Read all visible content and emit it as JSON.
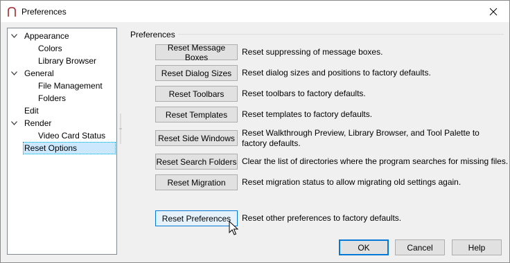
{
  "window": {
    "title": "Preferences"
  },
  "tree": {
    "items": [
      {
        "label": "Appearance",
        "expander": "expanded"
      },
      {
        "label": "Colors"
      },
      {
        "label": "Library Browser"
      },
      {
        "label": "General",
        "expander": "expanded"
      },
      {
        "label": "File Management"
      },
      {
        "label": "Folders"
      },
      {
        "label": "Edit"
      },
      {
        "label": "Render",
        "expander": "expanded"
      },
      {
        "label": "Video Card Status"
      },
      {
        "label": "Reset Options",
        "selected": true
      }
    ]
  },
  "group": {
    "title": "Preferences"
  },
  "resets": [
    {
      "button": "Reset Message Boxes",
      "desc": "Reset suppressing of message boxes."
    },
    {
      "button": "Reset Dialog Sizes",
      "desc": "Reset dialog sizes and positions to factory defaults."
    },
    {
      "button": "Reset Toolbars",
      "desc": "Reset toolbars to factory defaults."
    },
    {
      "button": "Reset Templates",
      "desc": "Reset templates to factory defaults."
    },
    {
      "button": "Reset Side Windows",
      "desc": "Reset Walkthrough Preview, Library Browser, and Tool Palette to factory defaults."
    },
    {
      "button": "Reset Search Folders",
      "desc": "Clear the list of directories where the program searches for missing files."
    },
    {
      "button": "Reset Migration",
      "desc": "Reset migration status to allow migrating old settings again."
    },
    {
      "button": "Reset Preferences",
      "desc": "Reset other preferences to factory defaults."
    }
  ],
  "footer": {
    "ok": "OK",
    "cancel": "Cancel",
    "help": "Help"
  },
  "colors": {
    "accent": "#0078d7",
    "selection": "#cce8ff",
    "app_icon": "#a4262c"
  },
  "icons": {
    "app": "chief-architect-icon",
    "close": "close-icon",
    "cursor": "mouse-pointer-icon"
  }
}
